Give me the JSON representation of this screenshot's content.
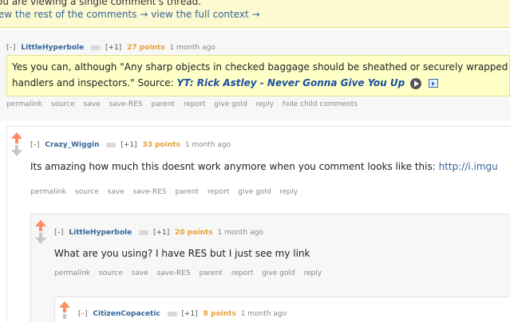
{
  "notice": {
    "line1": "ou are viewing a single comment's thread.",
    "rest_link": "ew the rest of the comments →",
    "context_link": "view the full context →"
  },
  "buttons": [
    "permalink",
    "source",
    "save",
    "save-RES",
    "parent",
    "report",
    "give gold",
    "reply"
  ],
  "comments": [
    {
      "toggle": "[–]",
      "author": "LittleHyperbole",
      "vote": "[+1]",
      "points": "27 points",
      "time": "1 month ago",
      "line1": "Yes you can, although \"Any sharp objects in checked baggage should be sheathed or securely wrapped",
      "line2": "handlers and inspectors.\" Source: ",
      "source_link": "YT: Rick Astley - Never Gonna Give You Up",
      "extra_button": "hide child comments"
    },
    {
      "toggle": "[–]",
      "author": "Crazy_Wiggin",
      "vote": "[+1]",
      "points": "33 points",
      "time": "1 month ago",
      "text": "Its amazing how much this doesnt work anymore when you comment looks like this: ",
      "link": "http://i.imgu"
    },
    {
      "toggle": "[–]",
      "author": "LittleHyperbole",
      "vote": "[+1]",
      "points": "20 points",
      "time": "1 month ago",
      "text": "What are you using? I have RES but I just see my link"
    },
    {
      "toggle": "[–]",
      "author": "CitizenCopacetic",
      "vote": "[+1]",
      "points": "8 points",
      "time": "1 month ago"
    }
  ],
  "colors": {
    "upvote": "#ff8b60",
    "points": "#e6a033",
    "author": "#336699",
    "highlight": "#ffffc8"
  }
}
